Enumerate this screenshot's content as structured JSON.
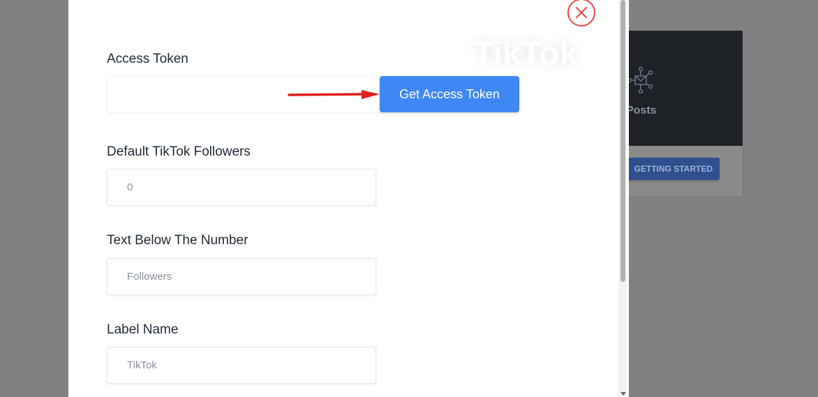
{
  "background": {
    "card_title": "Posts",
    "card_button": "GETTING STARTED"
  },
  "modal": {
    "watermark": "TikTok",
    "access_token": {
      "label": "Access Token",
      "value": "",
      "button_label": "Get Access Token"
    },
    "default_followers": {
      "label": "Default TikTok Followers",
      "placeholder": "0"
    },
    "text_below_number": {
      "label": "Text Below The Number",
      "placeholder": "Followers"
    },
    "label_name": {
      "label": "Label Name",
      "placeholder": "TikTok"
    }
  },
  "colors": {
    "primary_button": "#3f87f5",
    "close_icon": "#ef4444",
    "arrow": "#e11d1d"
  }
}
